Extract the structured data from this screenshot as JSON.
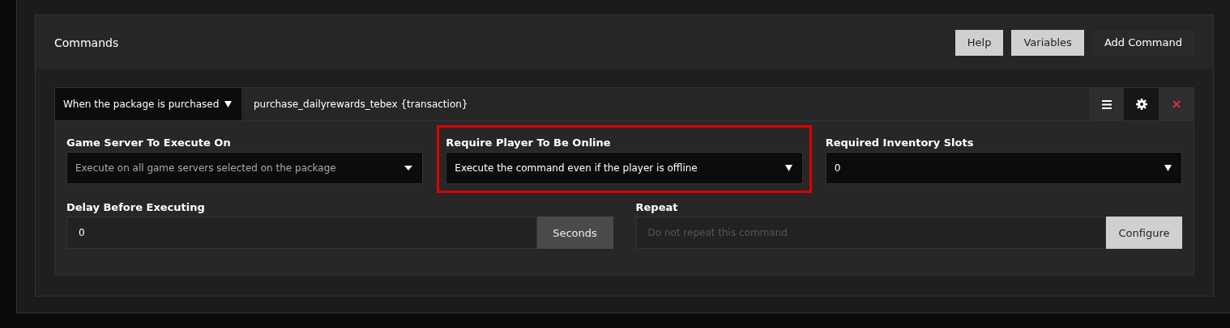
{
  "panel": {
    "title": "Commands",
    "buttons": [
      {
        "label": "Help",
        "kind": "light"
      },
      {
        "label": "Variables",
        "kind": "light"
      },
      {
        "label": "Add Command",
        "kind": "dark"
      }
    ]
  },
  "command": {
    "trigger": "When the package is purchased",
    "text": "purchase_dailyrewards_tebex {transaction}",
    "fields": [
      {
        "label": "Game Server To Execute On",
        "kind": "select",
        "value": "Execute on all game servers selected on the package",
        "muted": true,
        "highlighted": false
      },
      {
        "label": "Require Player To Be Online",
        "kind": "select",
        "value": "Execute the command even if the player is offline",
        "muted": false,
        "highlighted": true
      },
      {
        "label": "Required Inventory Slots",
        "kind": "select",
        "value": "0",
        "muted": false,
        "highlighted": false
      },
      {
        "label": "Delay Before Executing",
        "kind": "unit",
        "value": "0",
        "addon": "Seconds",
        "highlighted": false
      },
      {
        "label": "Repeat",
        "kind": "action",
        "placeholder": "Do not repeat this command",
        "addon": "Configure",
        "highlighted": false
      }
    ]
  }
}
